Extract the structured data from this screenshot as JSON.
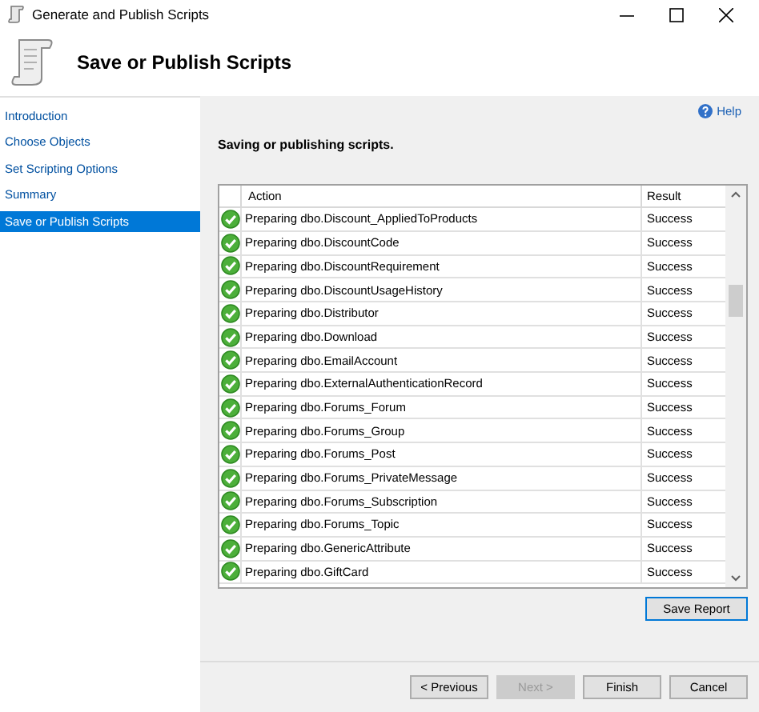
{
  "window": {
    "title": "Generate and Publish Scripts"
  },
  "header": {
    "title": "Save or Publish Scripts"
  },
  "sidebar": {
    "items": [
      {
        "label": "Introduction",
        "selected": false
      },
      {
        "label": "Choose Objects",
        "selected": false
      },
      {
        "label": "Set Scripting Options",
        "selected": false
      },
      {
        "label": "Summary",
        "selected": false
      },
      {
        "label": "Save or Publish Scripts",
        "selected": true
      }
    ]
  },
  "help": "Help",
  "status_text": "Saving or publishing scripts.",
  "table": {
    "columns": [
      "Action",
      "Result"
    ],
    "rows": [
      {
        "action": "Preparing dbo.Discount_AppliedToProducts",
        "result": "Success"
      },
      {
        "action": "Preparing dbo.DiscountCode",
        "result": "Success"
      },
      {
        "action": "Preparing dbo.DiscountRequirement",
        "result": "Success"
      },
      {
        "action": "Preparing dbo.DiscountUsageHistory",
        "result": "Success"
      },
      {
        "action": "Preparing dbo.Distributor",
        "result": "Success"
      },
      {
        "action": "Preparing dbo.Download",
        "result": "Success"
      },
      {
        "action": "Preparing dbo.EmailAccount",
        "result": "Success"
      },
      {
        "action": "Preparing dbo.ExternalAuthenticationRecord",
        "result": "Success"
      },
      {
        "action": "Preparing dbo.Forums_Forum",
        "result": "Success"
      },
      {
        "action": "Preparing dbo.Forums_Group",
        "result": "Success"
      },
      {
        "action": "Preparing dbo.Forums_Post",
        "result": "Success"
      },
      {
        "action": "Preparing dbo.Forums_PrivateMessage",
        "result": "Success"
      },
      {
        "action": "Preparing dbo.Forums_Subscription",
        "result": "Success"
      },
      {
        "action": "Preparing dbo.Forums_Topic",
        "result": "Success"
      },
      {
        "action": "Preparing dbo.GenericAttribute",
        "result": "Success"
      },
      {
        "action": "Preparing dbo.GiftCard",
        "result": "Success"
      }
    ]
  },
  "save_report": "Save Report",
  "buttons": [
    {
      "label": "< Previous",
      "disabled": false
    },
    {
      "label": "Next >",
      "disabled": true
    },
    {
      "label": "Finish",
      "disabled": false
    },
    {
      "label": "Cancel",
      "disabled": false
    }
  ]
}
